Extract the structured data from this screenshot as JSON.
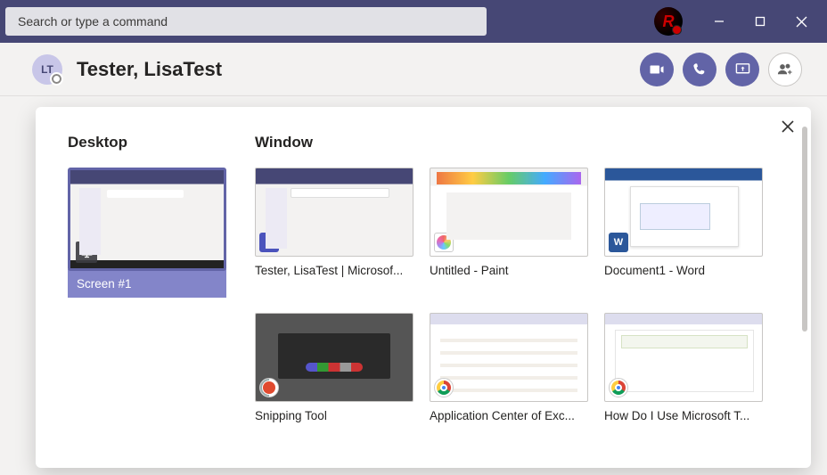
{
  "titlebar": {
    "search_placeholder": "Search or type a command",
    "org_avatar_letter": "R"
  },
  "chat_header": {
    "avatar_initials": "LT",
    "name": "Tester, LisaTest"
  },
  "share_panel": {
    "desktop_heading": "Desktop",
    "window_heading": "Window",
    "desktop": {
      "label": "Screen #1"
    },
    "windows": [
      {
        "label": "Tester, LisaTest | Microsof...",
        "app": "teams"
      },
      {
        "label": "Untitled - Paint",
        "app": "paint"
      },
      {
        "label": "Document1 - Word",
        "app": "word"
      },
      {
        "label": "Snipping Tool",
        "app": "snip"
      },
      {
        "label": "Application Center of Exc...",
        "app": "chrome"
      },
      {
        "label": "How Do I Use Microsoft T...",
        "app": "chrome"
      }
    ]
  }
}
